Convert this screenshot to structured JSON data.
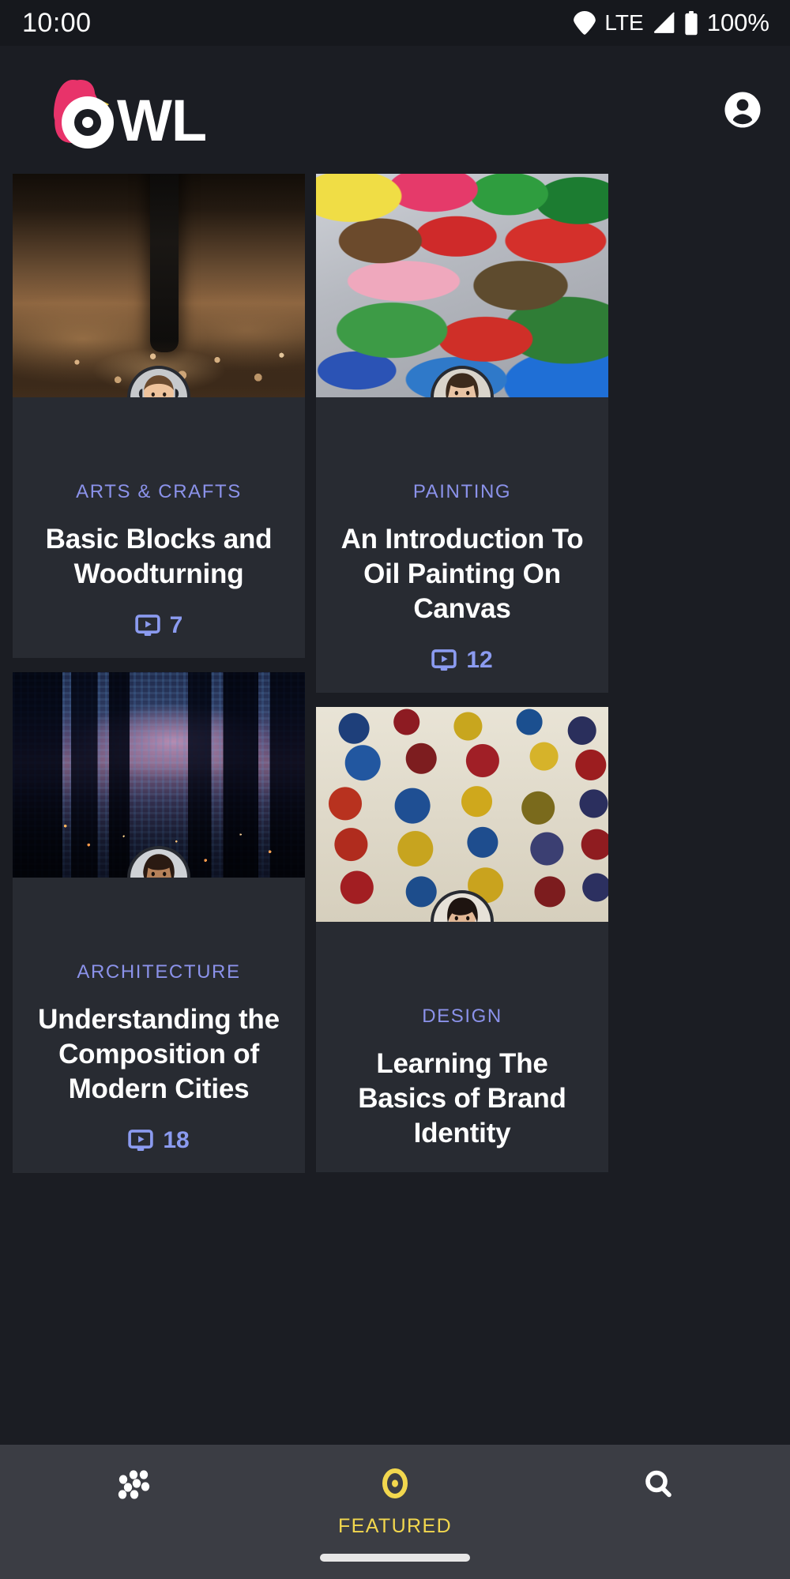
{
  "status_bar": {
    "time": "10:00",
    "network_label": "LTE",
    "battery_percent": "100%",
    "icons": [
      "wifi-icon",
      "signal-icon",
      "battery-icon"
    ]
  },
  "app_bar": {
    "brand_name": "OWL",
    "logo_icon": "owl-logo",
    "logo_colors": {
      "bird": "#E8336A",
      "beak": "#F5D94A",
      "wordmark": "#FFFFFF"
    },
    "account_icon": "account-circle-icon"
  },
  "theme": {
    "page_background": "#1b1d23",
    "card_background": "#282b32",
    "status_bar_background": "#16181d",
    "nav_background": "#3b3d44",
    "category_accent": "#8b92ea",
    "meta_accent": "#8b9bf0",
    "active_nav_accent": "#f2d74e",
    "title_color": "#ffffff"
  },
  "feed": {
    "left_column": [
      {
        "category": "ARTS & CRAFTS",
        "title": "Basic Blocks and Woodturning",
        "video_count": "7",
        "video_icon": "video-monitor-icon",
        "image_alt": "drill-bit-boring-into-wood",
        "image_class": "ph-drill",
        "media_height": 283,
        "avatar_alt": "avatar-male-smiling-headphones"
      },
      {
        "category": "ARCHITECTURE",
        "title": "Understanding the Composition of Modern Cities",
        "video_count": "18",
        "video_icon": "video-monitor-icon",
        "image_alt": "twilight-city-skyline-skyscrapers",
        "image_class": "ph-city",
        "media_height": 260,
        "avatar_alt": "avatar-woman-smiling"
      }
    ],
    "right_column": [
      {
        "category": "PAINTING",
        "title": "An Introduction To Oil Painting On Canvas",
        "video_count": "12",
        "video_icon": "video-monitor-icon",
        "image_alt": "colorful-oil-paint-palette",
        "image_class": "ph-palette",
        "media_height": 283,
        "avatar_alt": "avatar-woman-hand-on-chin"
      },
      {
        "category": "DESIGN",
        "title": "Learning The Basics of Brand Identity",
        "video_count": "",
        "video_icon": "video-monitor-icon",
        "image_alt": "wall-of-embroidered-patches-badges",
        "image_class": "ph-patches",
        "media_height": 272,
        "avatar_alt": "avatar-woman-short-dark-hair"
      }
    ]
  },
  "bottom_nav": {
    "items": [
      {
        "label": "",
        "icon": "dots-grid-icon",
        "active": false
      },
      {
        "label": "FEATURED",
        "icon": "eye-target-icon",
        "active": true
      },
      {
        "label": "",
        "icon": "search-icon",
        "active": false
      }
    ]
  }
}
